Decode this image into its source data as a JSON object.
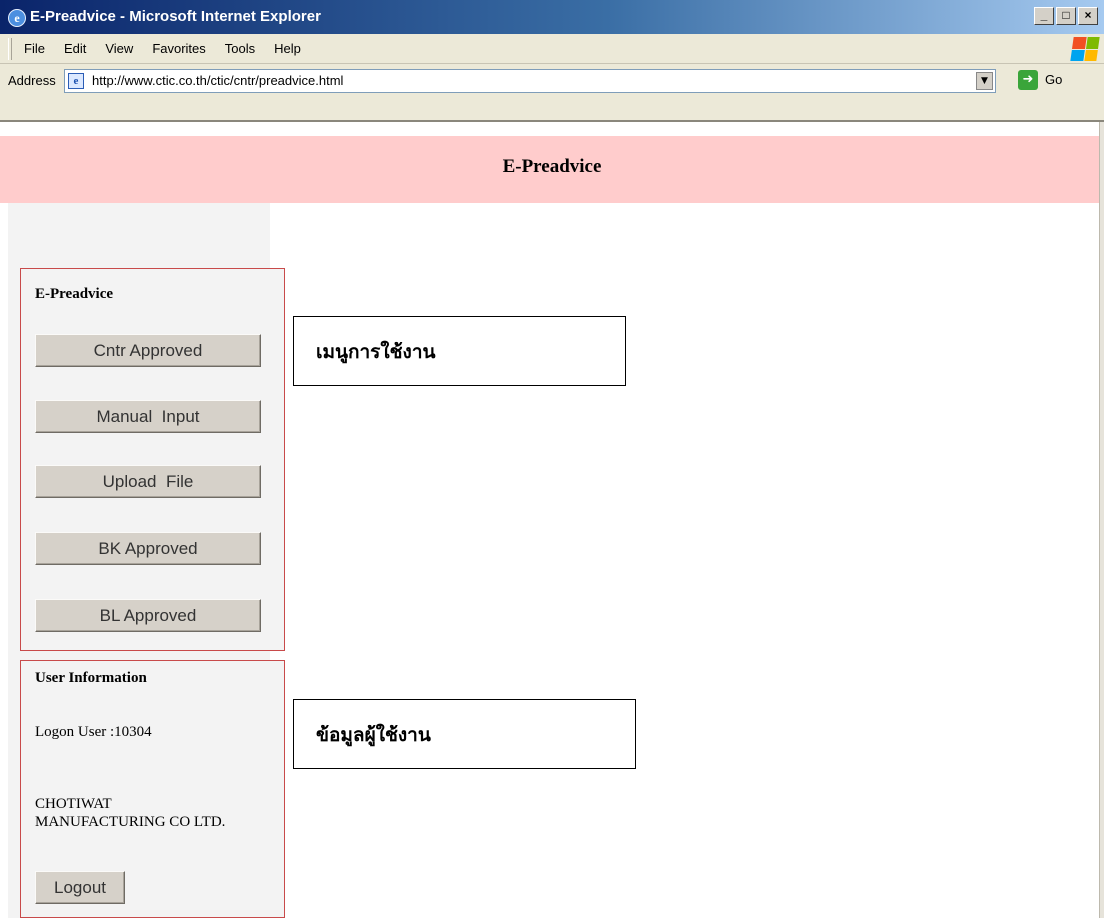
{
  "window": {
    "title": "E-Preadvice - Microsoft Internet Explorer",
    "minimize_glyph": "_",
    "maximize_glyph": "□",
    "close_glyph": "×"
  },
  "menubar": {
    "items": [
      "File",
      "Edit",
      "View",
      "Favorites",
      "Tools",
      "Help"
    ]
  },
  "address": {
    "label": "Address",
    "url": "http://www.ctic.co.th/ctic/cntr/preadvice.html",
    "go_label": "Go"
  },
  "page": {
    "header_title": "E-Preadvice",
    "menu_panel": {
      "heading": "E-Preadvice",
      "buttons": [
        "Cntr Approved",
        "Manual  Input",
        "Upload  File",
        "BK Approved",
        "BL Approved"
      ]
    },
    "user_panel": {
      "heading": "User Information",
      "logon_user": "Logon User :10304",
      "company": "CHOTIWAT MANUFACTURING CO LTD.",
      "logout_label": "Logout"
    },
    "callouts": {
      "menu": "เมนูการใช้งาน",
      "user_info": "ข้อมูลผู้ใช้งาน"
    }
  },
  "icons": {
    "window": "ie-icon",
    "address": "ie-page-icon",
    "go": "go-arrow-icon",
    "throbber": "windows-flag-icon",
    "dropdown": "chevron-down-icon"
  },
  "colors": {
    "header_band": "#ffcccc",
    "panel_border": "#c84a4a",
    "titlebar_start": "#0a246a",
    "button_face": "#d6d1c9"
  }
}
